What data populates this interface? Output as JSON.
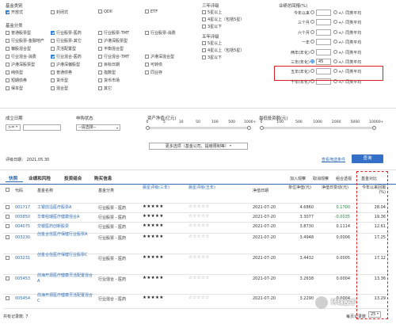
{
  "filters": {
    "fund_type": {
      "title": "基金类别",
      "items": [
        {
          "label": "开放式",
          "checked": true
        },
        {
          "label": "封闭式",
          "checked": false
        },
        {
          "label": "QDII",
          "checked": false
        },
        {
          "label": "ETF",
          "checked": false
        }
      ]
    },
    "fund_category": {
      "title": "基金分类",
      "grid": [
        [
          {
            "label": "普通股票型",
            "checked": false
          },
          {
            "label": "行业股票-医药",
            "checked": true
          },
          {
            "label": "行业股票-TMT",
            "checked": false
          },
          {
            "label": "行业股票-消费",
            "checked": false
          }
        ],
        [
          {
            "label": "行业股票-金融地产",
            "checked": false
          },
          {
            "label": "行业股票-其它",
            "checked": false
          },
          {
            "label": "沪港深股票型",
            "checked": false
          },
          {
            "label": "",
            "checked": false
          }
        ],
        [
          {
            "label": "偏股混合型",
            "checked": false
          },
          {
            "label": "灵活配置型",
            "checked": false
          },
          {
            "label": "平衡混合型",
            "checked": false
          },
          {
            "label": "",
            "checked": false
          }
        ],
        [
          {
            "label": "行业混合-消费",
            "checked": false
          },
          {
            "label": "行业混合-医药",
            "checked": true
          },
          {
            "label": "行业混合-TMT",
            "checked": false
          },
          {
            "label": "沪港深混合型",
            "checked": false
          }
        ],
        [
          {
            "label": "沪港深股票型",
            "checked": false
          },
          {
            "label": "沪港深偏股型",
            "checked": false
          },
          {
            "label": "目标日期",
            "checked": false
          },
          {
            "label": "可转债",
            "checked": false
          }
        ],
        [
          {
            "label": "纯债型",
            "checked": false
          },
          {
            "label": "普通债券",
            "checked": false
          },
          {
            "label": "指数型",
            "checked": false
          },
          {
            "label": "同业存",
            "checked": false
          }
        ],
        [
          {
            "label": "短期债券",
            "checked": false
          },
          {
            "label": "货币型",
            "checked": false
          },
          {
            "label": "货币市场",
            "checked": false
          },
          {
            "label": "",
            "checked": false
          }
        ],
        [
          {
            "label": "保本型",
            "checked": false
          },
          {
            "label": "混合型",
            "checked": false
          },
          {
            "label": "其它",
            "checked": false
          },
          {
            "label": "",
            "checked": false
          }
        ]
      ]
    },
    "rating3": {
      "title": "三年评级",
      "items": [
        {
          "label": "5星以上",
          "checked": false
        },
        {
          "label": "4星以上（包括5星）",
          "checked": false
        },
        {
          "label": "3星以下",
          "checked": false
        }
      ]
    },
    "rating5": {
      "title": "五年评级",
      "items": [
        {
          "label": "5星以上",
          "checked": false
        },
        {
          "label": "4星以上（包括5星）",
          "checked": false
        },
        {
          "label": "3星以下",
          "checked": false
        }
      ]
    },
    "returns": {
      "title": "业绩总回报(%)",
      "rows": [
        {
          "label": "今年以来",
          "value": "",
          "suffix": "同类平均"
        },
        {
          "label": "三个月",
          "value": "",
          "suffix": "同类平均"
        },
        {
          "label": "六个月",
          "value": "",
          "suffix": "同类平均"
        },
        {
          "label": "一年",
          "value": "",
          "suffix": "同类平均"
        },
        {
          "label": "两年(年化)",
          "value": "",
          "suffix": "同类平均"
        },
        {
          "label": "三年(年化)",
          "value": "45",
          "suffix": "同类平均"
        },
        {
          "label": "五年(年化)",
          "value": "",
          "suffix": "同类平均"
        },
        {
          "label": "十年(年化)",
          "value": "",
          "suffix": "同类平均"
        }
      ]
    },
    "established": {
      "title": "成立日期",
      "operator": ">=",
      "date": ""
    },
    "purchase": {
      "title": "申购状态",
      "value": "--请选择--"
    },
    "net_assets": {
      "title": "资产净值(亿元)",
      "ticks": [
        "0",
        "5",
        "10",
        "50",
        "100",
        "500",
        "1000+"
      ]
    },
    "min_invest": {
      "title": "最低投资额(元)",
      "ticks": [
        "0",
        "100",
        "500",
        "1000",
        "2000",
        "5000",
        "10000+"
      ]
    },
    "more_options": "更多选项（基金公司、提缴限制等）",
    "date_label": "评级日期：",
    "date_value": "2021.05.30",
    "save_link": "查看筛选条件",
    "query_button": "查询"
  },
  "tabs": [
    "快照",
    "业绩和风险",
    "投资组合",
    "购买信息"
  ],
  "toolbar": [
    "加入观察",
    "取消观察",
    "组合透视",
    "基金对比"
  ],
  "table": {
    "headers": [
      "代码",
      "基金名称",
      "基金分类",
      "晨星评级(三年)",
      "晨星评级(五年)",
      "净值日期",
      "单位净值(元)",
      "净值日变动(元)",
      "今年以来回报(%)"
    ],
    "rows": [
      {
        "code": "001717",
        "name": "工银前沿医疗股票A",
        "cat": "行业股票 - 医药",
        "r3": "★★★★★",
        "r5": "☆☆☆☆☆",
        "date": "2021-07-20",
        "nav": "4.6860",
        "chg": "0.1700",
        "chgc": "green",
        "ret": "28.04"
      },
      {
        "code": "005850",
        "name": "华泰柏瑞医疗健康混合A",
        "cat": "行业股票 - 医药",
        "r3": "★★★★★",
        "r5": "☆☆☆☆☆",
        "date": "2021-07-20",
        "nav": "3.3077",
        "chg": "-0.0035",
        "chgc": "green",
        "ret": "19.36"
      },
      {
        "code": "004075",
        "name": "交银医药创新股票",
        "cat": "行业股票 - 医药",
        "r3": "★★★★★",
        "r5": "☆☆☆☆☆",
        "date": "2021-07-20",
        "nav": "3.8730",
        "chg": "0.1114",
        "chgc": "black",
        "ret": "12.61"
      },
      {
        "code": "003230",
        "name": "创金合信医疗保健行业股票A",
        "cat": "行业股票 - 医药",
        "r3": "★★★★★",
        "r5": "☆☆☆☆☆",
        "date": "2021-07-20",
        "nav": "3.4948",
        "chg": "0.0006",
        "chgc": "black",
        "ret": "17.25"
      },
      {
        "code": "003231",
        "name": "创金合信医疗保健行业股票C",
        "cat": "行业股票 - 医药",
        "r3": "★★★★★",
        "r5": "☆☆☆☆☆",
        "date": "2021-07-20",
        "nav": "3.4432",
        "chg": "0.0005",
        "chgc": "black",
        "ret": "17.12"
      },
      {
        "code": "005453",
        "name": "前海开源医疗健康灵活配置混合A",
        "cat": "行业混合 - 医药",
        "r3": "★★★★★",
        "r5": "☆☆☆☆☆",
        "date": "2021-07-20",
        "nav": "3.2638",
        "chg": "0.0004",
        "chgc": "black",
        "ret": "13.36"
      },
      {
        "code": "005454",
        "name": "前海开源医疗健康灵活配置混合C",
        "cat": "行业混合 - 医药",
        "r3": "★★★★★",
        "r5": "☆☆☆☆☆",
        "date": "2021-07-20",
        "nav": "3.2290",
        "chg": "0.0004",
        "chgc": "black",
        "ret": "13.29"
      }
    ]
  },
  "footer": {
    "total": "共有记录数: 7",
    "per_page_label": "每页记录数",
    "per_page": "25"
  },
  "watermark": "环球投手"
}
